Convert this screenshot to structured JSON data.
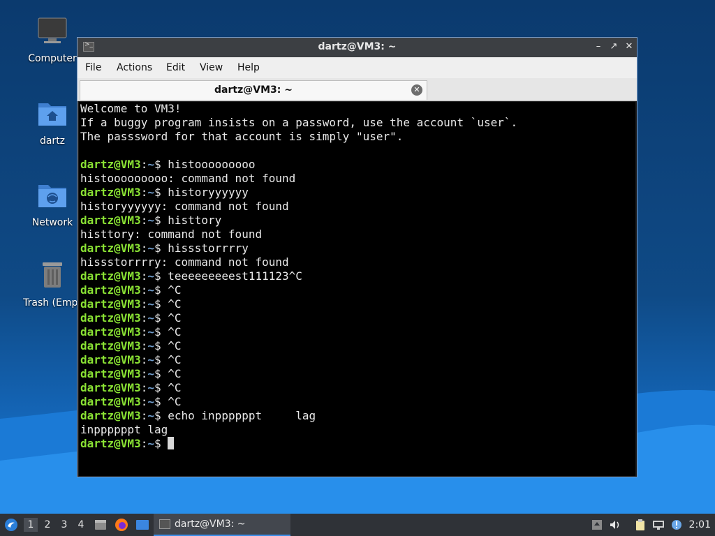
{
  "desktop": {
    "icons": [
      {
        "label": "Computer"
      },
      {
        "label": "dartz"
      },
      {
        "label": "Network"
      },
      {
        "label": "Trash (Empt"
      }
    ]
  },
  "window": {
    "title": "dartz@VM3: ~",
    "menu": [
      "File",
      "Actions",
      "Edit",
      "View",
      "Help"
    ],
    "tab_title": "dartz@VM3: ~",
    "terminal": {
      "prompt_user": "dartz@VM3",
      "prompt_path": "~",
      "welcome": [
        "Welcome to VM3!",
        "If a buggy program insists on a password, use the account `user`.",
        "The passsword for that account is simply \"user\"."
      ],
      "commands": [
        {
          "cmd": "histooooooooo",
          "out": "histooooooooo: command not found"
        },
        {
          "cmd": "historyyyyyy",
          "out": "historyyyyyy: command not found"
        },
        {
          "cmd": "histtory",
          "out": "histtory: command not found"
        },
        {
          "cmd": "hissstorrrry",
          "out": "hissstorrrry: command not found"
        },
        {
          "cmd": "teeeeeeeeest111123^C",
          "out": null
        },
        {
          "cmd": "^C",
          "out": null
        },
        {
          "cmd": "^C",
          "out": null
        },
        {
          "cmd": "^C",
          "out": null
        },
        {
          "cmd": "^C",
          "out": null
        },
        {
          "cmd": "^C",
          "out": null
        },
        {
          "cmd": "^C",
          "out": null
        },
        {
          "cmd": "^C",
          "out": null
        },
        {
          "cmd": "^C",
          "out": null
        },
        {
          "cmd": "^C",
          "out": null
        },
        {
          "cmd": "echo inppppppt     lag",
          "out": "inppppppt lag"
        },
        {
          "cmd": "",
          "out": null,
          "cursor": true
        }
      ]
    }
  },
  "taskbar": {
    "workspaces": [
      "1",
      "2",
      "3",
      "4"
    ],
    "active_workspace": "1",
    "task_label": "dartz@VM3: ~",
    "clock": "2:01"
  }
}
